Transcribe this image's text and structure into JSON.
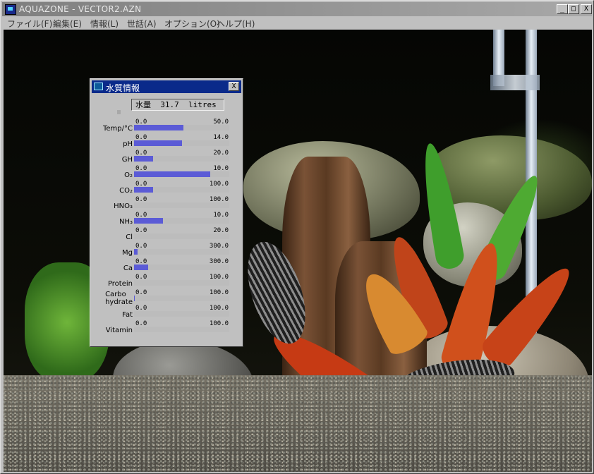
{
  "app": {
    "title": "AQUAZONE - VECTOR2.AZN",
    "minimize_glyph": "_",
    "maximize_glyph": "□",
    "close_glyph": "X"
  },
  "menu": [
    {
      "label": "ファイル(F)"
    },
    {
      "label": "編集(E)"
    },
    {
      "label": "情報(L)"
    },
    {
      "label": "世話(A)"
    },
    {
      "label": "オプション(O)"
    },
    {
      "label": "ヘルプ(H)"
    }
  ],
  "water_dialog": {
    "title": "水質情報",
    "close_glyph": "X",
    "volume_text": "水量  31.7  litres",
    "rows": [
      {
        "label": "Temp/°C",
        "min": "0.0",
        "max": "50.0",
        "fill": 0.52
      },
      {
        "label": "pH",
        "min": "0.0",
        "max": "14.0",
        "fill": 0.5
      },
      {
        "label": "GH",
        "min": "0.0",
        "max": "20.0",
        "fill": 0.2
      },
      {
        "label": "O₂",
        "min": "0.0",
        "max": "10.0",
        "fill": 0.8
      },
      {
        "label": "CO₂",
        "min": "0.0",
        "max": "100.0",
        "fill": 0.2
      },
      {
        "label": "HNO₃",
        "min": "0.0",
        "max": "100.0",
        "fill": 0.0
      },
      {
        "label": "NH₃",
        "min": "0.0",
        "max": "10.0",
        "fill": 0.3
      },
      {
        "label": "Cl",
        "min": "0.0",
        "max": "20.0",
        "fill": 0.0
      },
      {
        "label": "Mg",
        "min": "0.0",
        "max": "300.0",
        "fill": 0.04
      },
      {
        "label": "Ca",
        "min": "0.0",
        "max": "300.0",
        "fill": 0.15
      },
      {
        "label": "Protein",
        "min": "0.0",
        "max": "100.0",
        "fill": 0.0
      },
      {
        "label": "Carbo\nhydrate",
        "min": "0.0",
        "max": "100.0",
        "fill": 0.01
      },
      {
        "label": "Fat",
        "min": "0.0",
        "max": "100.0",
        "fill": 0.0
      },
      {
        "label": "Vitamin",
        "min": "0.0",
        "max": "100.0",
        "fill": 0.0
      }
    ]
  },
  "colors": {
    "bar_fill": "#5b5bd6",
    "dialog_title_bg": "#0a2a8a"
  }
}
